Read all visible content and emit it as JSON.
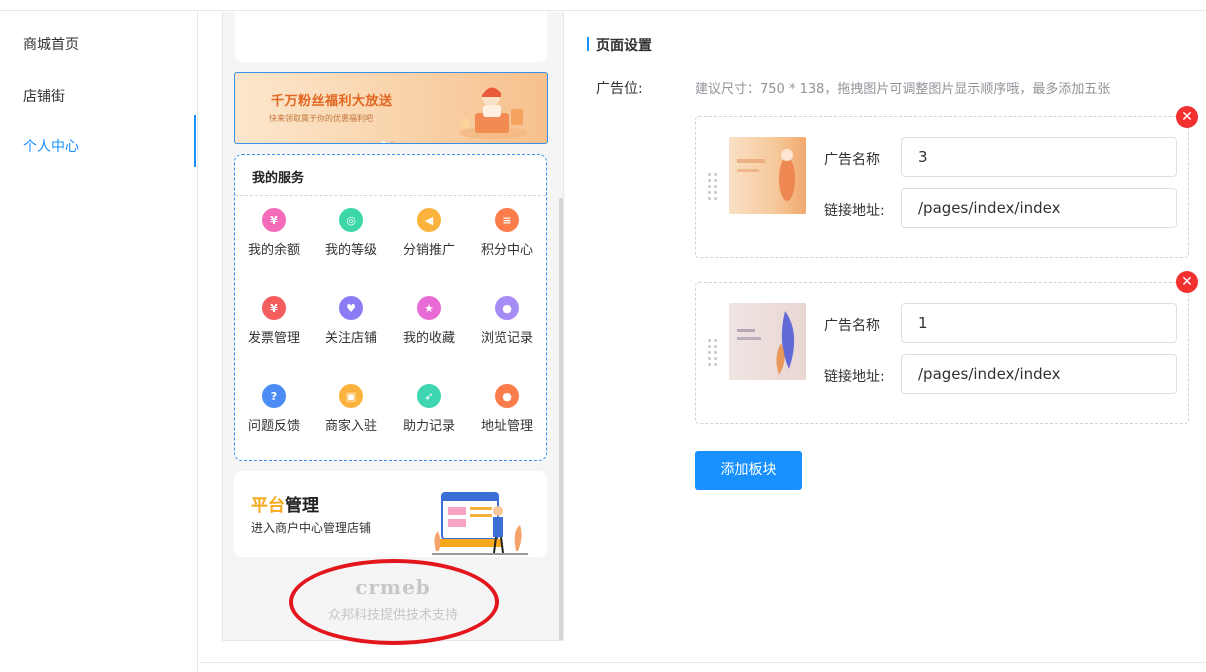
{
  "nav": {
    "items": [
      {
        "label": "商城首页",
        "active": false
      },
      {
        "label": "店铺街",
        "active": false
      },
      {
        "label": "个人中心",
        "active": true
      }
    ]
  },
  "preview": {
    "banner": {
      "title": "千万粉丝福利大放送",
      "subtitle": "快来领取属于你的优惠福利吧"
    },
    "services": {
      "title": "我的服务",
      "items": [
        {
          "label": "我的余额",
          "icon": "yuan-icon",
          "color": "#f36bb9",
          "glyph": "¥"
        },
        {
          "label": "我的等级",
          "icon": "medal-icon",
          "color": "#3dd6a6",
          "glyph": "◎"
        },
        {
          "label": "分销推广",
          "icon": "megaphone-icon",
          "color": "#fbb33d",
          "glyph": "◀"
        },
        {
          "label": "积分中心",
          "icon": "coins-icon",
          "color": "#fa7d4b",
          "glyph": "≡"
        },
        {
          "label": "发票管理",
          "icon": "invoice-icon",
          "color": "#f45d5d",
          "glyph": "¥"
        },
        {
          "label": "关注店铺",
          "icon": "heart-icon",
          "color": "#8b7cf6",
          "glyph": "♥"
        },
        {
          "label": "我的收藏",
          "icon": "star-icon",
          "color": "#e86bd5",
          "glyph": "★"
        },
        {
          "label": "浏览记录",
          "icon": "footprint-icon",
          "color": "#a58cf6",
          "glyph": "●"
        },
        {
          "label": "问题反馈",
          "icon": "question-icon",
          "color": "#4b8cf5",
          "glyph": "?"
        },
        {
          "label": "商家入驻",
          "icon": "shop-icon",
          "color": "#fbb33d",
          "glyph": "▣"
        },
        {
          "label": "助力记录",
          "icon": "rocket-icon",
          "color": "#3dd6b0",
          "glyph": "➶"
        },
        {
          "label": "地址管理",
          "icon": "location-icon",
          "color": "#fa7d4b",
          "glyph": "●"
        }
      ]
    },
    "platform": {
      "title_highlight": "平台",
      "title_rest": "管理",
      "subtitle": "进入商户中心管理店铺"
    },
    "footer": {
      "logo": "crmeb",
      "support": "众邦科技提供技术支持"
    }
  },
  "settings": {
    "title": "页面设置",
    "ad_label": "广告位:",
    "ad_hint": "建议尺寸：750 * 138，拖拽图片可调整图片显示顺序哦，最多添加五张",
    "name_label": "广告名称",
    "link_label": "链接地址:",
    "ads": [
      {
        "name": "3",
        "link": "/pages/index/index"
      },
      {
        "name": "1",
        "link": "/pages/index/index"
      }
    ],
    "add_button": "添加板块"
  },
  "colors": {
    "accent": "#1890ff",
    "danger": "#f23030",
    "highlight": "#f7a71a"
  }
}
